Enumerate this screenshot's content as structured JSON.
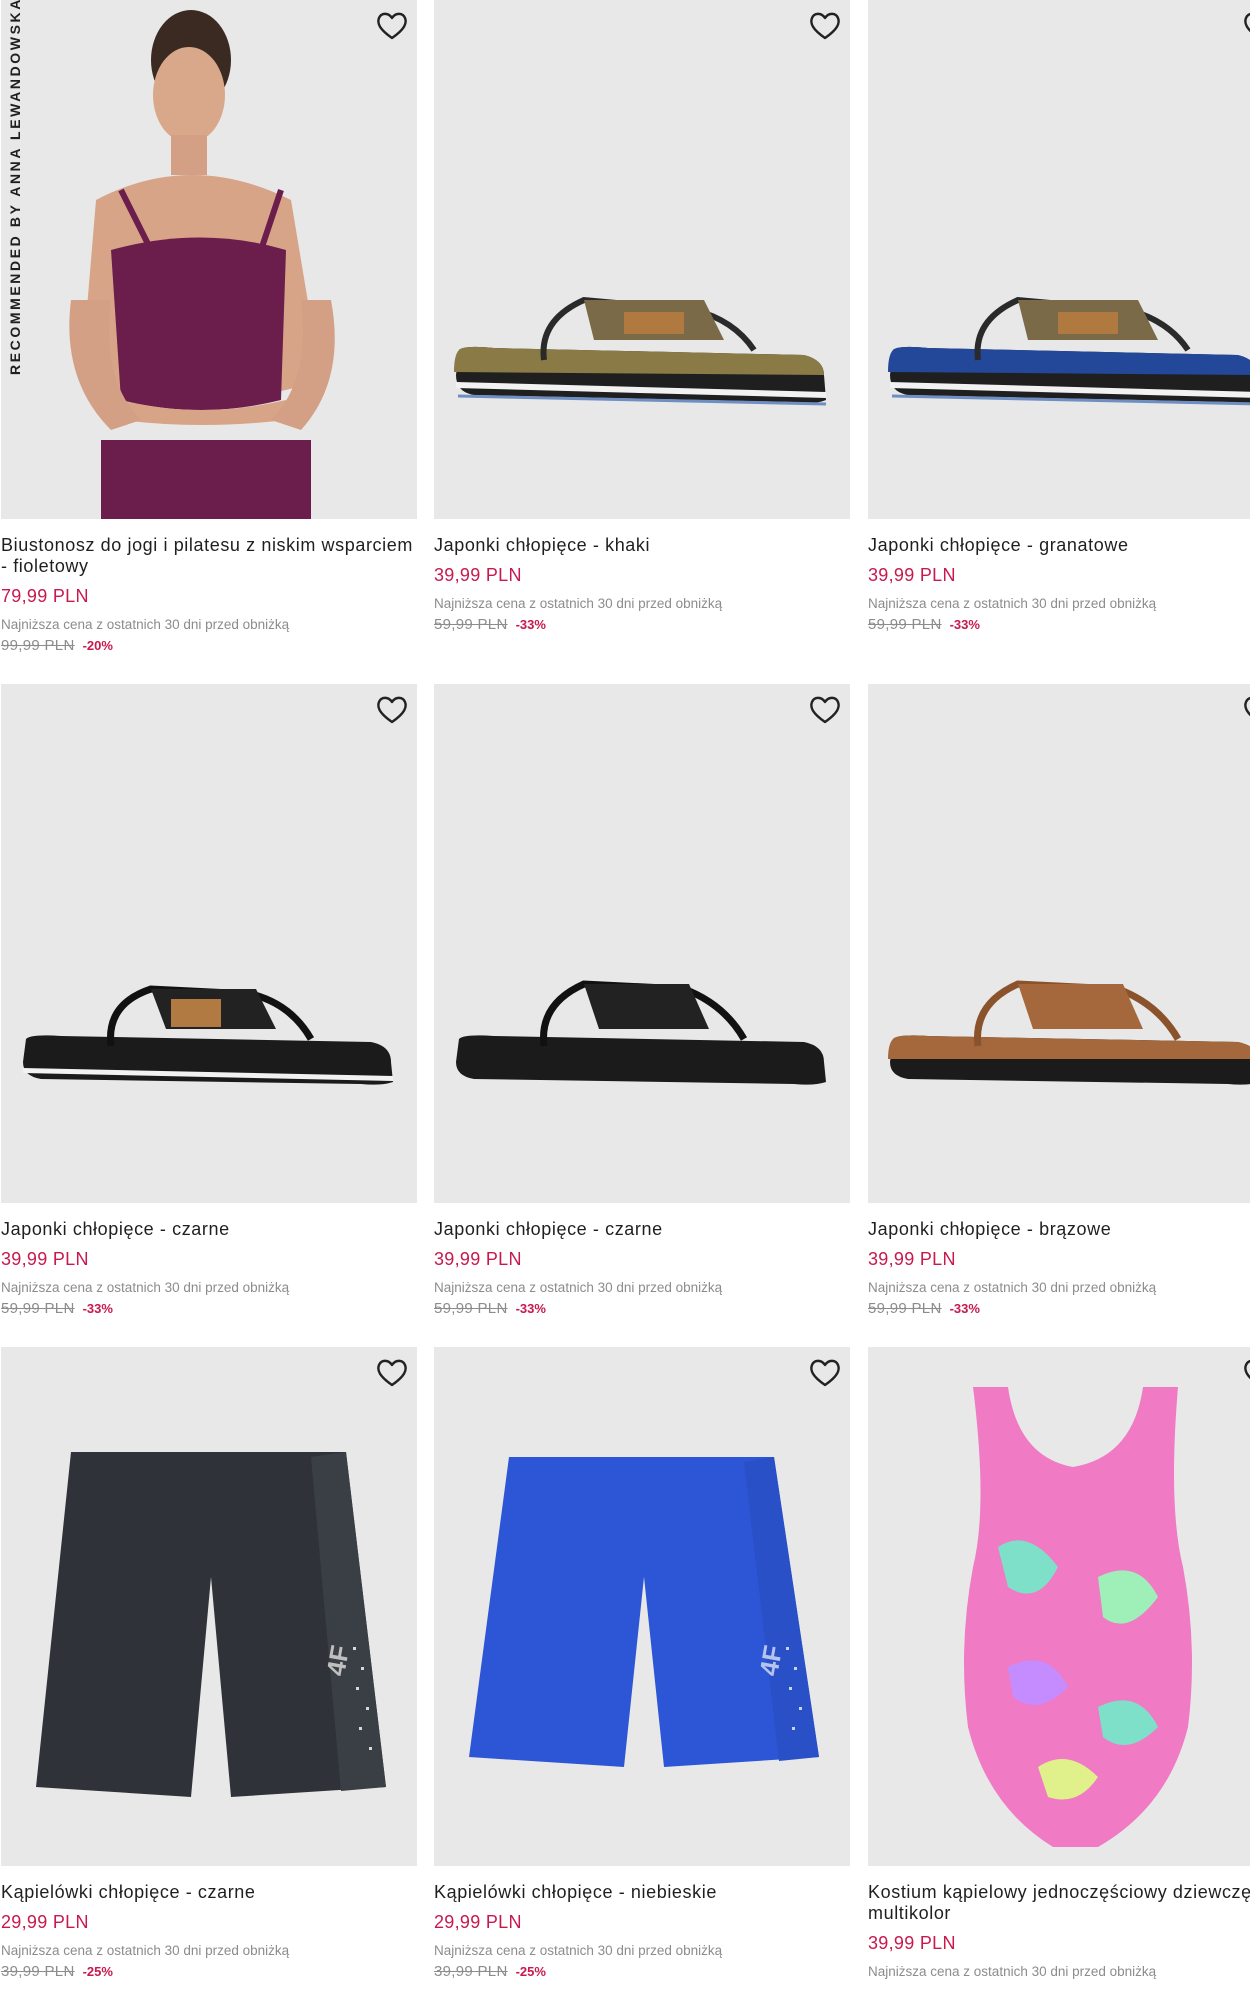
{
  "badge": "RECOMMENDED BY ANNA LEWANDOWSKA",
  "price_note": "Najniższa cena z ostatnich 30 dni przed obniżką",
  "accent_color": "#c8194e",
  "products": [
    {
      "name": "Biustonosz do jogi i pilatesu z niskim wsparciem - fioletowy",
      "price": "79,99 PLN",
      "old_price": "99,99 PLN",
      "discount": "-20%",
      "image": "purple-sports-bra-photo"
    },
    {
      "name": "Japonki chłopięce - khaki",
      "price": "39,99 PLN",
      "old_price": "59,99 PLN",
      "discount": "-33%",
      "image": "khaki-flip-flop-photo"
    },
    {
      "name": "Japonki chłopięce - granatowe",
      "price": "39,99 PLN",
      "old_price": "59,99 PLN",
      "discount": "-33%",
      "image": "navy-flip-flop-photo"
    },
    {
      "name": "Japonki chłopięce - czarne",
      "price": "39,99 PLN",
      "old_price": "59,99 PLN",
      "discount": "-33%",
      "image": "black-flip-flop-photo"
    },
    {
      "name": "Japonki chłopięce - czarne",
      "price": "39,99 PLN",
      "old_price": "59,99 PLN",
      "discount": "-33%",
      "image": "black-flip-flop-photo"
    },
    {
      "name": "Japonki chłopięce - brązowe",
      "price": "39,99 PLN",
      "old_price": "59,99 PLN",
      "discount": "-33%",
      "image": "brown-flip-flop-photo"
    },
    {
      "name": "Kąpielówki chłopięce - czarne",
      "price": "29,99 PLN",
      "old_price": "39,99 PLN",
      "discount": "-25%",
      "image": "black-swim-shorts-photo"
    },
    {
      "name": "Kąpielówki chłopięce - niebieskie",
      "price": "29,99 PLN",
      "old_price": "39,99 PLN",
      "discount": "-25%",
      "image": "blue-swim-shorts-photo"
    },
    {
      "name": "Kostium kąpielowy jednoczęściowy dziewczęcy - multikolor",
      "price": "39,99 PLN",
      "old_price": "",
      "discount": "",
      "image": "multicolor-swimsuit-photo"
    }
  ]
}
